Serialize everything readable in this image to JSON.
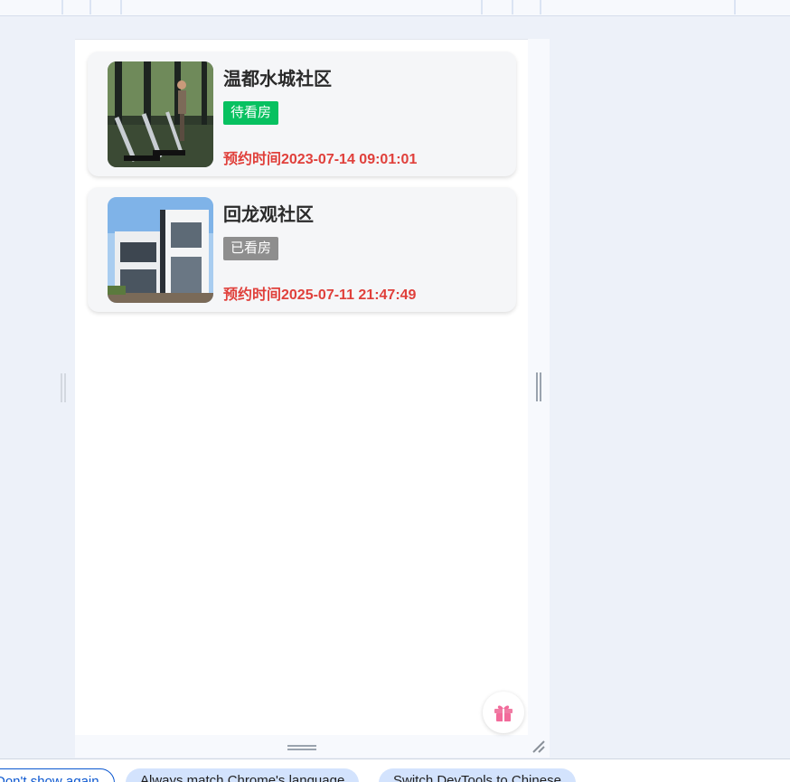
{
  "appointments": [
    {
      "name": "温都水城社区",
      "status": "待看房",
      "status_color": "#07c160",
      "time": "预约时间2023-07-14 09:01:01",
      "image": "gym-treadmill-photo"
    },
    {
      "name": "回龙观社区",
      "status": "已看房",
      "status_color": "#8e8e8e",
      "time": "预约时间2025-07-11 21:47:49",
      "image": "modern-villa-photo"
    }
  ],
  "gift_button": {
    "icon": "gift-icon"
  },
  "devtools_bar": {
    "dont_show": "Don't show again",
    "always_match": "Always match Chrome's language",
    "switch_chinese": "Switch DevTools to Chinese"
  },
  "colors": {
    "accent_red": "#e0403b",
    "pending_green": "#07c160",
    "done_gray": "#8e8e8e"
  }
}
